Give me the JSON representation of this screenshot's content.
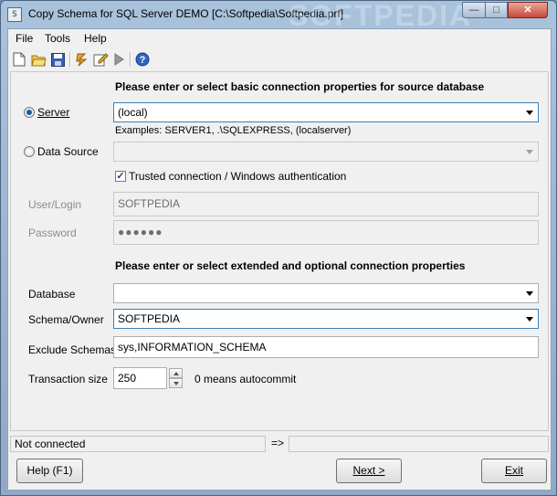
{
  "window": {
    "title": "Copy Schema for SQL Server DEMO [C:\\Softpedia\\Softpedia.prf]",
    "watermark": "SOFTPEDIA",
    "minimize_glyph": "—",
    "maximize_glyph": "□",
    "close_glyph": "✕"
  },
  "menu": {
    "file": "File",
    "tools": "Tools",
    "help": "Help"
  },
  "toolbar": {
    "icons": [
      "new-file-icon",
      "open-folder-icon",
      "save-icon",
      "connect-icon",
      "edit-properties-icon",
      "run-icon",
      "help-icon"
    ]
  },
  "basic": {
    "heading": "Please enter or select basic connection properties for source database",
    "server_label": "Server",
    "server_value": "(local)",
    "server_selected": true,
    "examples": "Examples: SERVER1, .\\SQLEXPRESS, (localserver)",
    "datasource_label": "Data Source",
    "datasource_value": "",
    "trusted_label": "Trusted connection / Windows authentication",
    "trusted_checked": true,
    "user_label": "User/Login",
    "user_value": "SOFTPEDIA",
    "password_label": "Password",
    "password_value": "●●●●●●"
  },
  "extended": {
    "heading": "Please enter or select extended and optional connection properties",
    "database_label": "Database",
    "database_value": "",
    "schema_label": "Schema/Owner",
    "schema_value": "SOFTPEDIA",
    "exclude_label": "Exclude Schemas",
    "exclude_value": "sys,INFORMATION_SCHEMA",
    "txsize_label": "Transaction size",
    "txsize_value": "250",
    "txsize_hint": "0 means autocommit"
  },
  "status": {
    "left": "Not connected",
    "middle": "=>",
    "right": ""
  },
  "buttons": {
    "help": "Help (F1)",
    "next": "Next >",
    "exit": "Exit"
  },
  "colors": {
    "title_gradient_top": "#a9c3dd",
    "close_red": "#c8473a",
    "radio_dot": "#1f5aa6",
    "focus_border": "#3c7fb1"
  }
}
